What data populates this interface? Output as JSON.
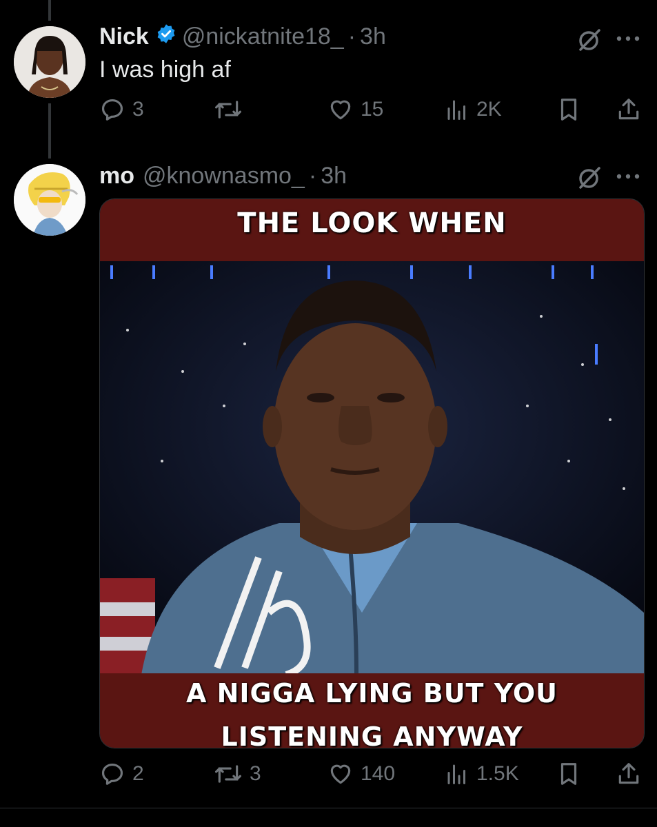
{
  "tweets": [
    {
      "name": "Nick",
      "verified": true,
      "handle": "@nickatnite18_",
      "separator": "·",
      "time": "3h",
      "text": "I was high af",
      "actions": {
        "replies": "3",
        "retweets": "",
        "likes": "15",
        "views": "2K"
      }
    },
    {
      "name": "mo",
      "verified": false,
      "handle": "@knownasmo_",
      "separator": "·",
      "time": "3h",
      "media": {
        "caption_top": "THE LOOK WHEN",
        "caption_bottom_line1": "A NIGGA LYING BUT YOU",
        "caption_bottom_line2": "LISTENING ANYWAY"
      },
      "actions": {
        "replies": "2",
        "retweets": "3",
        "likes": "140",
        "views": "1.5K"
      }
    }
  ],
  "icons": {
    "verified": "verified-badge-icon",
    "grok": "grok-icon",
    "more": "more-icon",
    "reply": "reply-icon",
    "retweet": "retweet-icon",
    "like": "heart-icon",
    "views": "views-icon",
    "bookmark": "bookmark-icon",
    "share": "share-icon"
  },
  "colors": {
    "background": "#000000",
    "text": "#e7e9ea",
    "muted": "#71767b",
    "verified": "#1d9bf0"
  }
}
